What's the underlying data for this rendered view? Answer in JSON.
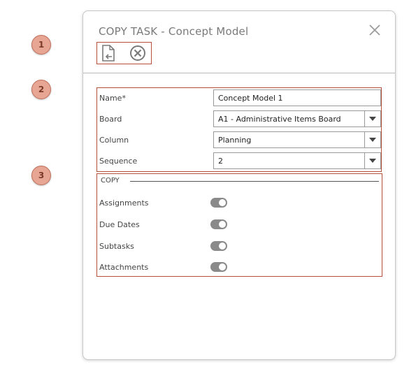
{
  "callouts": [
    "1",
    "2",
    "3"
  ],
  "dialog": {
    "title": "COPY TASK - Concept Model",
    "close_icon": "close-icon",
    "toolbar": {
      "copy_icon": "copy-document-icon",
      "cancel_icon": "cancel-circle-icon"
    }
  },
  "form": {
    "name_label": "Name*",
    "name_value": "Concept Model 1",
    "board_label": "Board",
    "board_value": "A1 - Administrative Items Board",
    "column_label": "Column",
    "column_value": "Planning",
    "sequence_label": "Sequence",
    "sequence_value": "2"
  },
  "copy_section": {
    "heading": "COPY",
    "options": [
      {
        "label": "Assignments",
        "on": true
      },
      {
        "label": "Due Dates",
        "on": true
      },
      {
        "label": "Subtasks",
        "on": true
      },
      {
        "label": "Attachments",
        "on": true
      }
    ]
  },
  "colors": {
    "callout_fill": "#e7a593",
    "highlight_border": "#b5503a",
    "toggle": "#8a8a8a"
  }
}
